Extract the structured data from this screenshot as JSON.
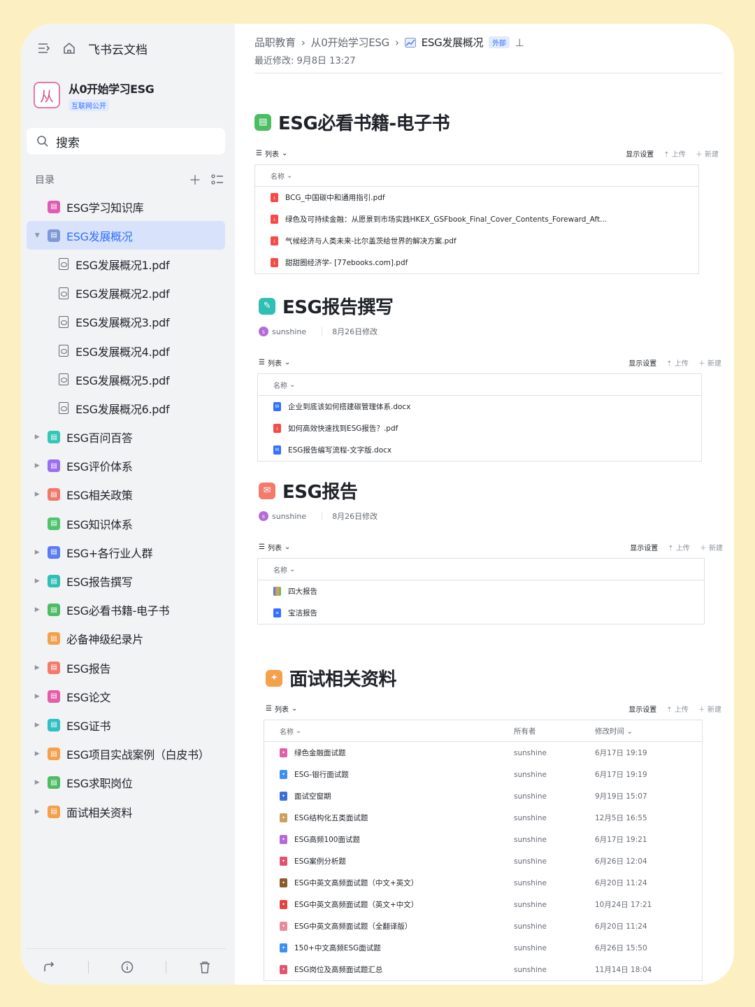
{
  "sidebar": {
    "app_name": "飞书云文档",
    "space_name": "从0开始学习ESG",
    "space_logo": "从",
    "space_badge": "互联网公开",
    "search_label": "搜索",
    "toc_label": "目录",
    "items": [
      {
        "label": "ESG学习知识库",
        "color": "#e05bb3",
        "arrow": ""
      },
      {
        "label": "ESG发展概况",
        "color": "#7e9ad6",
        "arrow": "▼",
        "selected": true
      },
      {
        "label": "ESG发展概况1.pdf",
        "child": true
      },
      {
        "label": "ESG发展概况2.pdf",
        "child": true
      },
      {
        "label": "ESG发展概况3.pdf",
        "child": true
      },
      {
        "label": "ESG发展概况4.pdf",
        "child": true
      },
      {
        "label": "ESG发展概况5.pdf",
        "child": true
      },
      {
        "label": "ESG发展概况6.pdf",
        "child": true
      },
      {
        "label": "ESG百问百答",
        "color": "#35c6b8",
        "arrow": "▶"
      },
      {
        "label": "ESG评价体系",
        "color": "#9a6ef0",
        "arrow": "▶"
      },
      {
        "label": "ESG相关政策",
        "color": "#f2786a",
        "arrow": "▶"
      },
      {
        "label": "ESG知识体系",
        "color": "#4ec46c",
        "arrow": ""
      },
      {
        "label": "ESG+各行业人群",
        "color": "#5b7cf6",
        "arrow": "▶"
      },
      {
        "label": "ESG报告撰写",
        "color": "#2fbfb4",
        "arrow": "▶"
      },
      {
        "label": "ESG必看书籍-电子书",
        "color": "#4cbd63",
        "arrow": "▶"
      },
      {
        "label": "必备神级纪录片",
        "color": "#f5a04a",
        "arrow": ""
      },
      {
        "label": "ESG报告",
        "color": "#f27b6c",
        "arrow": "▶"
      },
      {
        "label": "ESG论文",
        "color": "#e35ea8",
        "arrow": "▶"
      },
      {
        "label": "ESG证书",
        "color": "#2fbfc4",
        "arrow": "▶"
      },
      {
        "label": "ESG项目实战案例（白皮书）",
        "color": "#f5a04a",
        "arrow": "▶"
      },
      {
        "label": "ESG求职岗位",
        "color": "#4cbd63",
        "arrow": "▶"
      },
      {
        "label": "面试相关资料",
        "color": "#f5a04a",
        "arrow": "▶"
      }
    ]
  },
  "header": {
    "crumbs": [
      "品职教育",
      "从0开始学习ESG",
      "ESG发展概况"
    ],
    "tag": "外部",
    "modified": "最近修改: 9月8日 13:27"
  },
  "toolbar": {
    "list_label": "列表",
    "display_label": "显示设置",
    "upload_label": "上传",
    "new_label": "新建",
    "name_col": "名称",
    "owner_col": "所有者",
    "time_col": "修改时间"
  },
  "sections": {
    "books": {
      "title": "ESG必看书籍-电子书",
      "color": "#4cbd63",
      "files": [
        {
          "name": "BCG_中国碳中和通用指引.pdf",
          "type": "pdf"
        },
        {
          "name": "绿色及可持续金融：从愿景到市场实践HKEX_GSFbook_Final_Cover_Contents_Foreward_Aft...",
          "type": "pdf"
        },
        {
          "name": "气候经济与人类未来-比尔盖茨给世界的解决方案.pdf",
          "type": "pdf"
        },
        {
          "name": "甜甜圈经济学- [77ebooks.com].pdf",
          "type": "pdf"
        }
      ]
    },
    "writing": {
      "title": "ESG报告撰写",
      "color": "#2fbfb4",
      "author": "sunshine",
      "modified": "8月26日修改",
      "files": [
        {
          "name": "企业到底该如何搭建碳管理体系.docx",
          "type": "doc"
        },
        {
          "name": "如何高效快速找到ESG报告？.pdf",
          "type": "pdf"
        },
        {
          "name": "ESG报告编写流程-文字版.docx",
          "type": "doc"
        }
      ]
    },
    "reports": {
      "title": "ESG报告",
      "color": "#f27b6c",
      "author": "sunshine",
      "modified": "8月26日修改",
      "files": [
        {
          "name": "四大报告",
          "type": "multi"
        },
        {
          "name": "宝洁报告",
          "type": "docx"
        }
      ]
    },
    "interview": {
      "title": "面试相关资料",
      "color": "#f5a04a",
      "files": [
        {
          "name": "绿色金融面试题",
          "owner": "sunshine",
          "time": "6月17日 19:19",
          "color": "#e35ea8"
        },
        {
          "name": "ESG-银行面试题",
          "owner": "sunshine",
          "time": "6月17日 19:19",
          "color": "#3d8ff0"
        },
        {
          "name": "面试空窗期",
          "owner": "sunshine",
          "time": "9月19日 15:07",
          "color": "#3b6fd8"
        },
        {
          "name": "ESG结构化五类面试题",
          "owner": "sunshine",
          "time": "12月5日 16:55",
          "color": "#c9a25c"
        },
        {
          "name": "ESG高频100面试题",
          "owner": "sunshine",
          "time": "6月17日 19:21",
          "color": "#b46ad8"
        },
        {
          "name": "ESG案例分析题",
          "owner": "sunshine",
          "time": "6月26日 12:04",
          "color": "#e2546e"
        },
        {
          "name": "ESG中英文高频面试题（中文+英文）",
          "owner": "sunshine",
          "time": "6月20日 11:24",
          "color": "#8a5a2b"
        },
        {
          "name": "ESG中英文高频面试题（英文+中文）",
          "owner": "sunshine",
          "time": "10月24日 17:21",
          "color": "#e2443e"
        },
        {
          "name": "ESG中英文高频面试题（全翻译版）",
          "owner": "sunshine",
          "time": "6月20日 11:24",
          "color": "#e88a9a"
        },
        {
          "name": "150+中文高频ESG面试题",
          "owner": "sunshine",
          "time": "6月26日 15:50",
          "color": "#3d8ff0"
        },
        {
          "name": "ESG岗位及高频面试题汇总",
          "owner": "sunshine",
          "time": "11月14日 18:04",
          "color": "#e2546e"
        }
      ]
    }
  }
}
